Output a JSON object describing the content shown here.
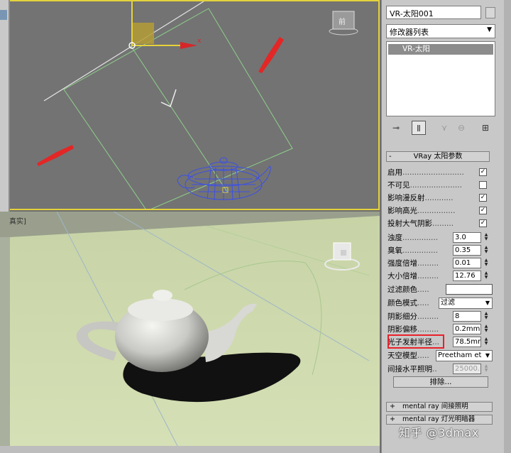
{
  "viewport_top": {
    "axis_label_x": "x",
    "viewcube_label": "前"
  },
  "viewport_persp": {
    "label": "真实]"
  },
  "panel": {
    "object_name": "VR-太阳001",
    "modifier_list_label": "修改器列表",
    "stack_item": "VR-太阳",
    "rollout_title": "VRay 太阳参数",
    "rows": [
      {
        "label": "启用",
        "type": "check",
        "checked": true
      },
      {
        "label": "不可见",
        "type": "check",
        "checked": false
      },
      {
        "label": "影响漫反射",
        "type": "check",
        "checked": true
      },
      {
        "label": "影响高光",
        "type": "check",
        "checked": true
      },
      {
        "label": "投射大气阴影",
        "type": "check",
        "checked": true
      },
      {
        "label": "浊度",
        "type": "spin",
        "value": "3.0"
      },
      {
        "label": "臭氧",
        "type": "spin",
        "value": "0.35"
      },
      {
        "label": "强度倍增",
        "type": "spin",
        "value": "0.01"
      },
      {
        "label": "大小倍增",
        "type": "spin",
        "value": "12.76"
      },
      {
        "label": "过滤颜色",
        "type": "color",
        "value": "#ffffff"
      },
      {
        "label": "颜色模式",
        "type": "dropdown",
        "value": "过滤"
      },
      {
        "label": "阴影细分",
        "type": "spin",
        "value": "8"
      },
      {
        "label": "阴影偏移",
        "type": "spin",
        "value": "0.2mm"
      },
      {
        "label": "光子发射半径",
        "type": "spin",
        "value": "78.5mr"
      },
      {
        "label": "天空模型",
        "type": "dropdown",
        "value": "Preetham et"
      },
      {
        "label": "间接水平照明",
        "type": "spin",
        "value": "25000.",
        "disabled": true
      }
    ],
    "exclude_button": "排除...",
    "sub_rollouts": [
      {
        "label": "mental ray 间接照明"
      },
      {
        "label": "mental ray 灯光明暗器"
      }
    ]
  },
  "watermark": "知乎 @3dmax"
}
